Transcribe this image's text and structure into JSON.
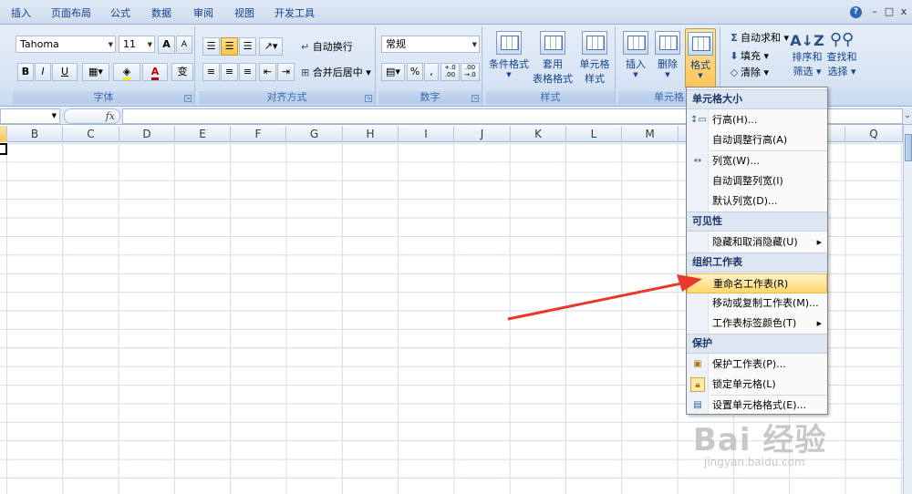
{
  "tabs": [
    "插入",
    "页面布局",
    "公式",
    "数据",
    "审阅",
    "视图",
    "开发工具"
  ],
  "window": {
    "help": "?",
    "minimize": "–",
    "restore": "□",
    "close": "x"
  },
  "font": {
    "name": "Tahoma",
    "size": "11",
    "bold": "B",
    "italic": "I",
    "underline": "U",
    "grow": "A",
    "shrink": "A",
    "color_letter": "A",
    "phonetic": "变"
  },
  "alignment": {
    "wrap_text": "自动换行",
    "merge_center": "合并后居中"
  },
  "number": {
    "format": "常规",
    "percent": "%",
    "comma": ",",
    "inc_decimal": "+.0 .00",
    "dec_decimal": ".00 →.0"
  },
  "styles": {
    "conditional_format": "条件格式",
    "format_as_table_1": "套用",
    "format_as_table_2": "表格格式",
    "cell_styles_1": "单元格",
    "cell_styles_2": "样式"
  },
  "cells": {
    "insert": "插入",
    "delete": "删除",
    "format": "格式"
  },
  "editing": {
    "autosum": "自动求和",
    "fill": "填充",
    "clear": "清除",
    "sort_filter_1": "排序和",
    "sort_filter_2": "筛选",
    "find_select_1": "查找和",
    "find_select_2": "选择",
    "sigma": "Σ"
  },
  "groups": {
    "font": "字体",
    "alignment": "对齐方式",
    "number": "数字",
    "styles": "样式",
    "cells": "单元格"
  },
  "formula_bar": {
    "fx": "fx"
  },
  "columns": [
    "B",
    "C",
    "D",
    "E",
    "F",
    "G",
    "H",
    "I",
    "J",
    "K",
    "L",
    "M",
    "N",
    "O",
    "P",
    "Q"
  ],
  "menu": {
    "sections": [
      {
        "title": "单元格大小",
        "items": [
          {
            "label": "行高(H)..."
          },
          {
            "label": "自动调整行高(A)"
          },
          {
            "label": "列宽(W)..."
          },
          {
            "label": "自动调整列宽(I)"
          },
          {
            "label": "默认列宽(D)..."
          }
        ]
      },
      {
        "title": "可见性",
        "items": [
          {
            "label": "隐藏和取消隐藏(U)"
          }
        ]
      },
      {
        "title": "组织工作表",
        "items": [
          {
            "label": "重命名工作表(R)"
          },
          {
            "label": "移动或复制工作表(M)..."
          },
          {
            "label": "工作表标签颜色(T)"
          }
        ]
      },
      {
        "title": "保护",
        "items": [
          {
            "label": "保护工作表(P)..."
          },
          {
            "label": "锁定单元格(L)"
          },
          {
            "label": "设置单元格格式(E)..."
          }
        ]
      }
    ]
  },
  "watermark": {
    "brand": "Bai 经验",
    "url": "jingyan.baidu.com"
  },
  "colors": {
    "accent": "#15428b",
    "highlight": "#ffd86b",
    "arrow": "#e8392c"
  }
}
